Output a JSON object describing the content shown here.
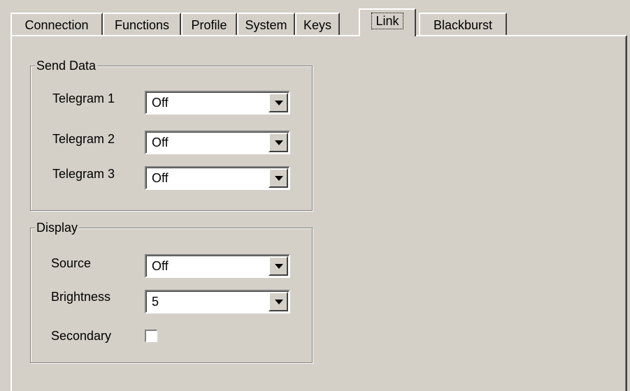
{
  "tabs": [
    {
      "label": "Connection"
    },
    {
      "label": "Functions"
    },
    {
      "label": "Profile"
    },
    {
      "label": "System"
    },
    {
      "label": "Keys"
    },
    {
      "label": "Link",
      "active": true
    },
    {
      "label": "Blackburst"
    }
  ],
  "send_data": {
    "title": "Send Data",
    "rows": [
      {
        "label": "Telegram 1",
        "value": "Off"
      },
      {
        "label": "Telegram 2",
        "value": "Off"
      },
      {
        "label": "Telegram 3",
        "value": "Off"
      }
    ]
  },
  "display": {
    "title": "Display",
    "source": {
      "label": "Source",
      "value": "Off"
    },
    "brightness": {
      "label": "Brightness",
      "value": "5"
    },
    "secondary": {
      "label": "Secondary",
      "checked": false
    }
  },
  "icons": {
    "dropdown": "chevron-down-icon"
  },
  "colors": {
    "face": "#d4d0c8",
    "field": "#ffffff",
    "shadow": "#808080"
  }
}
